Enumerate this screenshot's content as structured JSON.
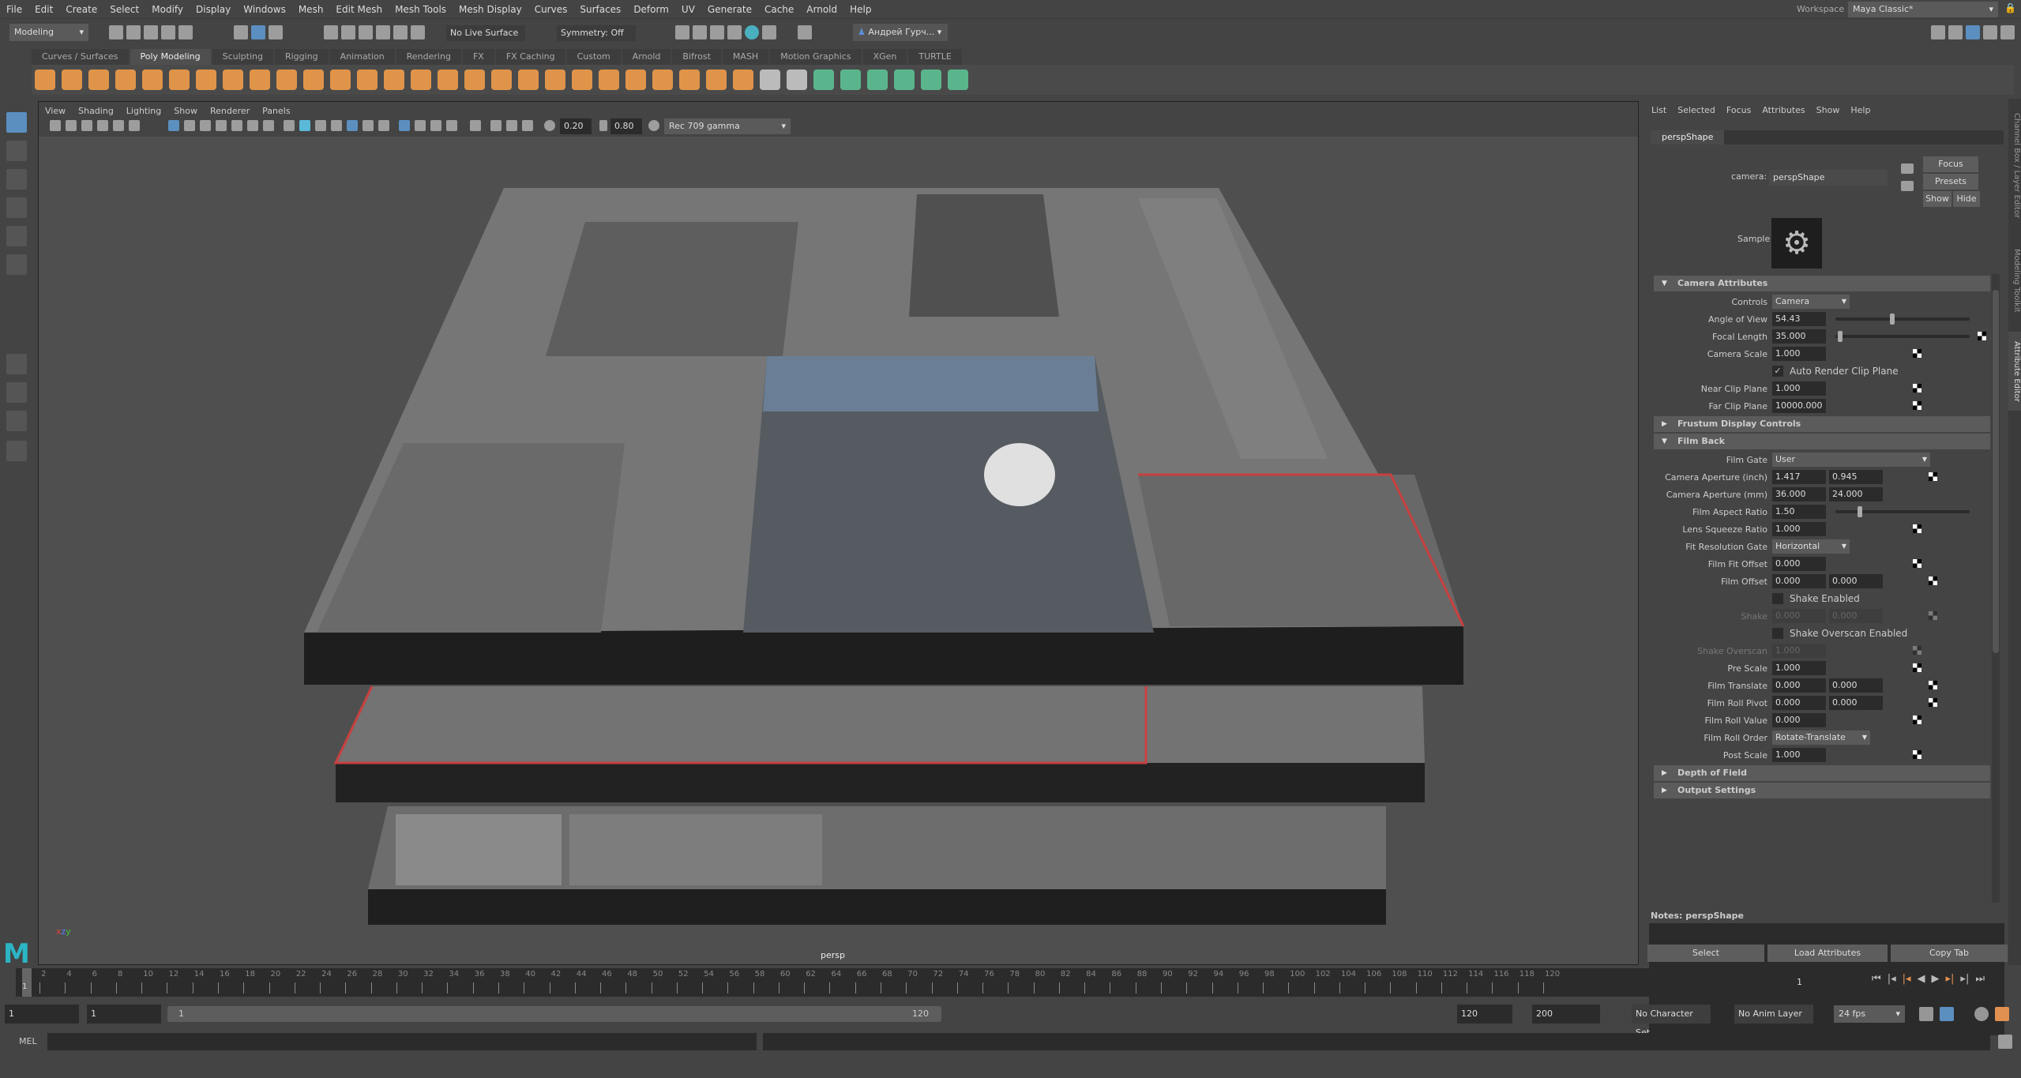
{
  "menubar": {
    "items": [
      "File",
      "Edit",
      "Create",
      "Select",
      "Modify",
      "Display",
      "Windows",
      "Mesh",
      "Edit Mesh",
      "Mesh Tools",
      "Mesh Display",
      "Curves",
      "Surfaces",
      "Deform",
      "UV",
      "Generate",
      "Cache",
      "Arnold",
      "Help"
    ],
    "workspace_label": "Workspace :",
    "workspace_value": "Maya Classic*"
  },
  "statusline": {
    "mode": "Modeling",
    "live_surface": "No Live Surface",
    "symmetry": "Symmetry: Off",
    "user": "Андрей Гурч..."
  },
  "shelf": {
    "tabs": [
      "Curves / Surfaces",
      "Poly Modeling",
      "Sculpting",
      "Rigging",
      "Animation",
      "Rendering",
      "FX",
      "FX Caching",
      "Custom",
      "Arnold",
      "Bifrost",
      "MASH",
      "Motion Graphics",
      "XGen",
      "TURTLE"
    ],
    "active_tab": "Poly Modeling",
    "orange": "#e0944a",
    "green": "#5bb58c"
  },
  "viewport": {
    "menus": [
      "View",
      "Shading",
      "Lighting",
      "Show",
      "Renderer",
      "Panels"
    ],
    "exposure": "0.20",
    "gamma": "0.80",
    "color_space": "Rec 709 gamma",
    "camera_label": "persp"
  },
  "attr_editor": {
    "menus": [
      "List",
      "Selected",
      "Focus",
      "Attributes",
      "Show",
      "Help"
    ],
    "tab": "perspShape",
    "camera_label": "camera:",
    "camera_value": "perspShape",
    "buttons": {
      "focus": "Focus",
      "presets": "Presets",
      "show": "Show",
      "hide": "Hide"
    },
    "sample_label": "Sample",
    "sections": [
      {
        "title": "Camera Attributes",
        "open": true,
        "rows": [
          {
            "label": "Controls",
            "type": "select",
            "value": "Camera"
          },
          {
            "label": "Angle of View",
            "type": "slider",
            "values": [
              "54.43"
            ],
            "slider": 0.42
          },
          {
            "label": "Focal Length",
            "type": "slider",
            "values": [
              "35.000"
            ],
            "slider": 0.02,
            "map": true
          },
          {
            "label": "Camera Scale",
            "values": [
              "1.000"
            ],
            "map": true
          },
          {
            "label": "",
            "type": "check",
            "checked": true,
            "text": "Auto Render Clip Plane"
          },
          {
            "label": "Near Clip Plane",
            "values": [
              "1.000"
            ],
            "map": true
          },
          {
            "label": "Far Clip Plane",
            "values": [
              "10000.000"
            ],
            "map": true
          }
        ]
      },
      {
        "title": "Frustum Display Controls",
        "open": false,
        "rows": []
      },
      {
        "title": "Film Back",
        "open": true,
        "rows": [
          {
            "label": "Film Gate",
            "type": "select",
            "value": "User",
            "wide": true
          },
          {
            "label": "Camera Aperture (inch)",
            "values": [
              "1.417",
              "0.945"
            ],
            "map": true
          },
          {
            "label": "Camera Aperture (mm)",
            "values": [
              "36.000",
              "24.000"
            ]
          },
          {
            "label": "Film Aspect Ratio",
            "type": "slider",
            "values": [
              "1.50"
            ],
            "slider": 0.17
          },
          {
            "label": "Lens Squeeze Ratio",
            "values": [
              "1.000"
            ],
            "map": true
          },
          {
            "label": "Fit Resolution Gate",
            "type": "select",
            "value": "Horizontal"
          },
          {
            "label": "Film Fit Offset",
            "values": [
              "0.000"
            ],
            "map": true
          },
          {
            "label": "Film Offset",
            "values": [
              "0.000",
              "0.000"
            ],
            "map": true
          },
          {
            "label": "",
            "type": "check",
            "checked": false,
            "text": "Shake Enabled"
          },
          {
            "label": "Shake",
            "values": [
              "0.000",
              "0.000"
            ],
            "dim": true,
            "map": true
          },
          {
            "label": "",
            "type": "check",
            "checked": false,
            "text": "Shake Overscan Enabled"
          },
          {
            "label": "Shake Overscan",
            "values": [
              "1.000"
            ],
            "dim": true,
            "map": true
          },
          {
            "label": "Pre Scale",
            "values": [
              "1.000"
            ],
            "map": true
          },
          {
            "label": "Film Translate",
            "values": [
              "0.000",
              "0.000"
            ],
            "map": true
          },
          {
            "label": "Film Roll Pivot",
            "values": [
              "0.000",
              "0.000"
            ],
            "map": true
          },
          {
            "label": "Film Roll Value",
            "values": [
              "0.000"
            ],
            "map": true
          },
          {
            "label": "Film Roll Order",
            "type": "select",
            "value": "Rotate-Translate"
          },
          {
            "label": "Post Scale",
            "values": [
              "1.000"
            ],
            "map": true
          }
        ]
      },
      {
        "title": "Depth of Field",
        "open": false,
        "rows": []
      },
      {
        "title": "Output Settings",
        "open": false,
        "rows": []
      }
    ],
    "notes_label": "Notes:  perspShape",
    "bottom_buttons": [
      "Select",
      "Load Attributes",
      "Copy Tab"
    ],
    "side_tabs": [
      "Channel Box / Layer Editor",
      "Modeling Toolkit",
      "Attribute Editor"
    ]
  },
  "timeline": {
    "start": 1,
    "end": 120,
    "current": 1,
    "current_field": "1"
  },
  "range": {
    "start": "1",
    "inner_start": "1",
    "slider_start": "1",
    "slider_end": "120",
    "end": "120",
    "max_end": "200",
    "character_set": "No Character Set",
    "anim_layer": "No Anim Layer",
    "fps": "24 fps"
  },
  "cmdline": {
    "label": "MEL"
  }
}
